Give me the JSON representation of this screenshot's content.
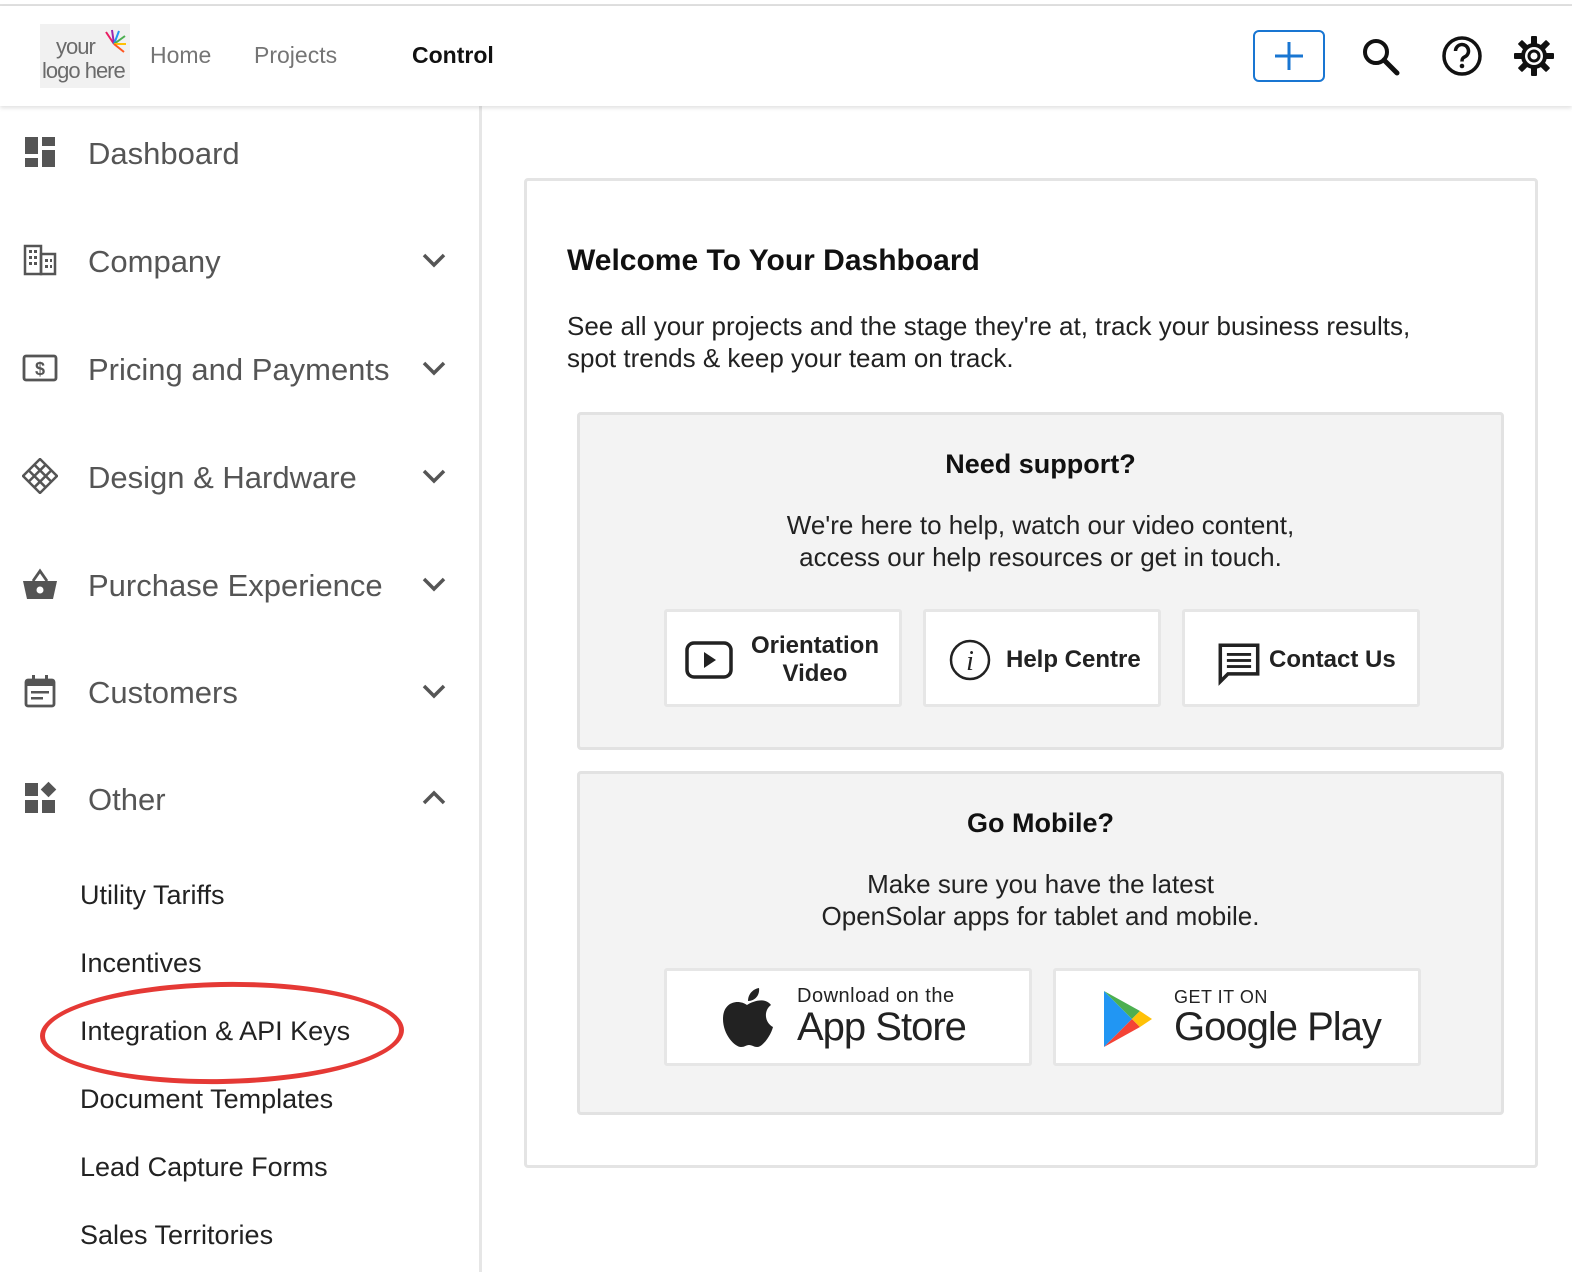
{
  "header": {
    "logo": {
      "line1": "your",
      "line2": "logo here"
    },
    "nav": [
      {
        "label": "Home",
        "active": false
      },
      {
        "label": "Projects",
        "active": false
      },
      {
        "label": "Control",
        "active": true
      }
    ],
    "accent_color": "#1976d2",
    "icons": [
      "plus-icon",
      "search-icon",
      "help-icon",
      "gear-icon"
    ]
  },
  "sidebar": {
    "items": [
      {
        "label": "Dashboard",
        "icon": "dashboard-icon",
        "expandable": false
      },
      {
        "label": "Company",
        "icon": "building-icon",
        "expandable": true,
        "expanded": false
      },
      {
        "label": "Pricing and Payments",
        "icon": "dollar-icon",
        "expandable": true,
        "expanded": false
      },
      {
        "label": "Design & Hardware",
        "icon": "grid-diamond-icon",
        "expandable": true,
        "expanded": false
      },
      {
        "label": "Purchase Experience",
        "icon": "basket-icon",
        "expandable": true,
        "expanded": false
      },
      {
        "label": "Customers",
        "icon": "calendar-icon",
        "expandable": true,
        "expanded": false
      },
      {
        "label": "Other",
        "icon": "widgets-icon",
        "expandable": true,
        "expanded": true
      }
    ],
    "other_subitems": [
      "Utility Tariffs",
      "Incentives",
      "Integration & API Keys",
      "Document Templates",
      "Lead Capture Forms",
      "Sales Territories"
    ],
    "highlight_color": "#e53935"
  },
  "main": {
    "title": "Welcome To Your Dashboard",
    "text_line1": "See all your projects and the stage they're at, track your business results,",
    "text_line2": "spot trends & keep your team on track.",
    "support": {
      "title": "Need support?",
      "line1": "We're here to help, watch our video content,",
      "line2": "access our help resources or get in touch.",
      "buttons": [
        {
          "line1": "Orientation",
          "line2": "Video",
          "icon": "play-icon"
        },
        {
          "label": "Help Centre",
          "icon": "info-icon"
        },
        {
          "label": "Contact Us",
          "icon": "chat-icon"
        }
      ]
    },
    "mobile": {
      "title": "Go Mobile?",
      "line1": "Make sure you have the latest",
      "line2": "OpenSolar apps for tablet and mobile.",
      "app_store": {
        "small": "Download on the",
        "big": "App Store",
        "icon": "apple-icon"
      },
      "google_play": {
        "small": "GET IT ON",
        "big": "Google Play",
        "icon": "google-play-icon"
      }
    }
  }
}
